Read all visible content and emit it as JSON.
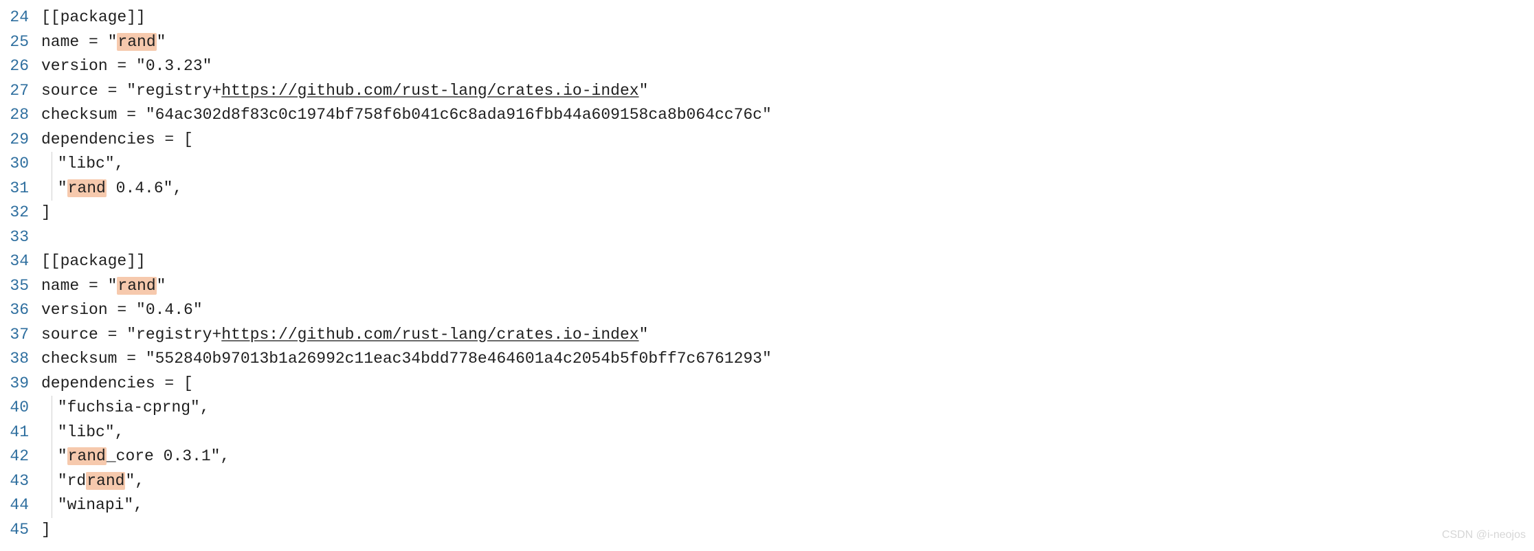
{
  "start_line_number": 24,
  "watermark": "CSDN @i-neojos",
  "highlight_term": "rand",
  "lines": [
    {
      "segments": [
        {
          "t": "[[package]]"
        }
      ]
    },
    {
      "segments": [
        {
          "t": "name = \""
        },
        {
          "t": "rand",
          "hl": true
        },
        {
          "t": "\""
        }
      ]
    },
    {
      "segments": [
        {
          "t": "version = \"0.3.23\""
        }
      ]
    },
    {
      "segments": [
        {
          "t": "source = \"registry+"
        },
        {
          "t": "https://github.com/rust-lang/crates.io-index",
          "link": true
        },
        {
          "t": "\""
        }
      ]
    },
    {
      "segments": [
        {
          "t": "checksum = \"64ac302d8f83c0c1974bf758f6b041c6c8ada916fbb44a609158ca8b064cc76c\""
        }
      ]
    },
    {
      "segments": [
        {
          "t": "dependencies = ["
        }
      ]
    },
    {
      "indent": true,
      "segments": [
        {
          "t": "\"libc\","
        }
      ]
    },
    {
      "indent": true,
      "segments": [
        {
          "t": "\""
        },
        {
          "t": "rand",
          "hl": true
        },
        {
          "t": " 0.4.6\","
        }
      ]
    },
    {
      "segments": [
        {
          "t": "]"
        }
      ]
    },
    {
      "segments": [
        {
          "t": ""
        }
      ]
    },
    {
      "segments": [
        {
          "t": "[[package]]"
        }
      ]
    },
    {
      "segments": [
        {
          "t": "name = \""
        },
        {
          "t": "rand",
          "hl": true
        },
        {
          "t": "\""
        }
      ]
    },
    {
      "segments": [
        {
          "t": "version = \"0.4.6\""
        }
      ]
    },
    {
      "segments": [
        {
          "t": "source = \"registry+"
        },
        {
          "t": "https://github.com/rust-lang/crates.io-index",
          "link": true
        },
        {
          "t": "\""
        }
      ]
    },
    {
      "segments": [
        {
          "t": "checksum = \"552840b97013b1a26992c11eac34bdd778e464601a4c2054b5f0bff7c6761293\""
        }
      ]
    },
    {
      "segments": [
        {
          "t": "dependencies = ["
        }
      ]
    },
    {
      "indent": true,
      "segments": [
        {
          "t": "\"fuchsia-cprng\","
        }
      ]
    },
    {
      "indent": true,
      "segments": [
        {
          "t": "\"libc\","
        }
      ]
    },
    {
      "indent": true,
      "segments": [
        {
          "t": "\""
        },
        {
          "t": "rand",
          "hl": true
        },
        {
          "t": "_core 0.3.1\","
        }
      ]
    },
    {
      "indent": true,
      "segments": [
        {
          "t": "\"rd"
        },
        {
          "t": "rand",
          "hl": true
        },
        {
          "t": "\","
        }
      ]
    },
    {
      "indent": true,
      "segments": [
        {
          "t": "\"winapi\","
        }
      ]
    },
    {
      "segments": [
        {
          "t": "]"
        }
      ]
    }
  ]
}
